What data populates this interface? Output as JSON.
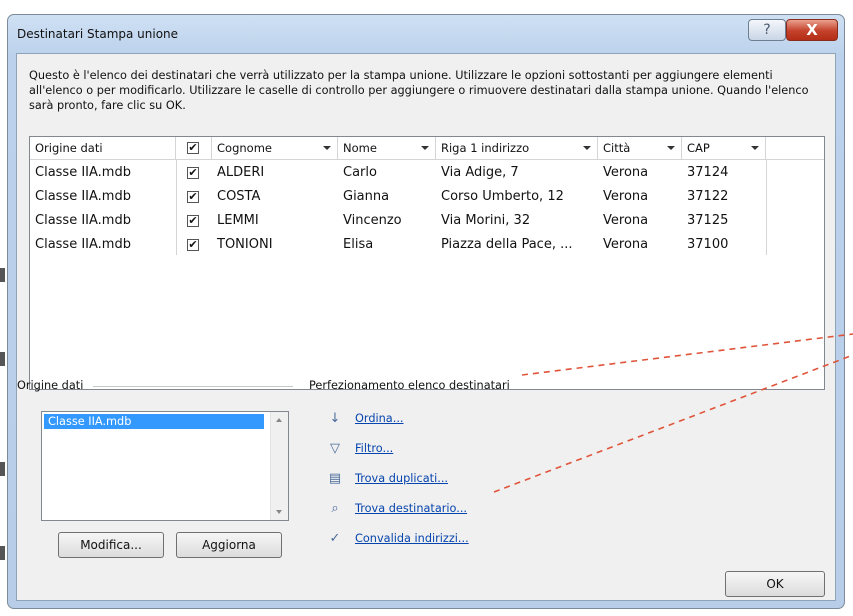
{
  "window": {
    "title": "Destinatari Stampa unione",
    "help_glyph": "?",
    "close_glyph": "X"
  },
  "description": "Questo è l'elenco dei destinatari che verrà utilizzato per la stampa unione. Utilizzare le opzioni sottostanti per aggiungere elementi all'elenco o per modificarlo. Utilizzare le caselle di controllo per aggiungere o rimuovere destinatari dalla stampa unione. Quando l'elenco sarà pronto, fare clic su OK.",
  "table": {
    "headers": {
      "source": "Origine dati",
      "check": "✔",
      "cognome": "Cognome",
      "nome": "Nome",
      "riga1": "Riga 1 indirizzo",
      "citta": "Città",
      "cap": "CAP"
    },
    "rows": [
      {
        "source": "Classe IIA.mdb",
        "checked": "✔",
        "cognome": "ALDERI",
        "nome": "Carlo",
        "riga1": "Via Adige, 7",
        "citta": "Verona",
        "cap": "37124"
      },
      {
        "source": "Classe IIA.mdb",
        "checked": "✔",
        "cognome": "COSTA",
        "nome": "Gianna",
        "riga1": "Corso Umberto, 12",
        "citta": "Verona",
        "cap": "37122"
      },
      {
        "source": "Classe IIA.mdb",
        "checked": "✔",
        "cognome": "LEMMI",
        "nome": "Vincenzo",
        "riga1": "Via Morini, 32",
        "citta": "Verona",
        "cap": "37125"
      },
      {
        "source": "Classe IIA.mdb",
        "checked": "✔",
        "cognome": "TONIONI",
        "nome": "Elisa",
        "riga1": "Piazza della Pace, ...",
        "citta": "Verona",
        "cap": "37100"
      }
    ]
  },
  "data_source": {
    "label": "Origine dati",
    "items": [
      "Classe IIA.mdb"
    ],
    "modify_button": "Modifica...",
    "update_button": "Aggiorna"
  },
  "refine": {
    "label": "Perfezionamento elenco destinatari",
    "links": {
      "sort": "Ordina...",
      "filter": "Filtro...",
      "duplicates": "Trova duplicati...",
      "find": "Trova destinatario...",
      "validate": "Convalida indirizzi..."
    }
  },
  "ok_button": "OK",
  "colors": {
    "annotation_dash": "#e0543a",
    "selection": "#3399ff",
    "link": "#0645ad"
  },
  "icons": {
    "sort": "sort-az-icon",
    "filter": "filter-icon",
    "duplicates": "duplicates-icon",
    "find": "find-recipient-icon",
    "validate": "validate-address-icon"
  }
}
